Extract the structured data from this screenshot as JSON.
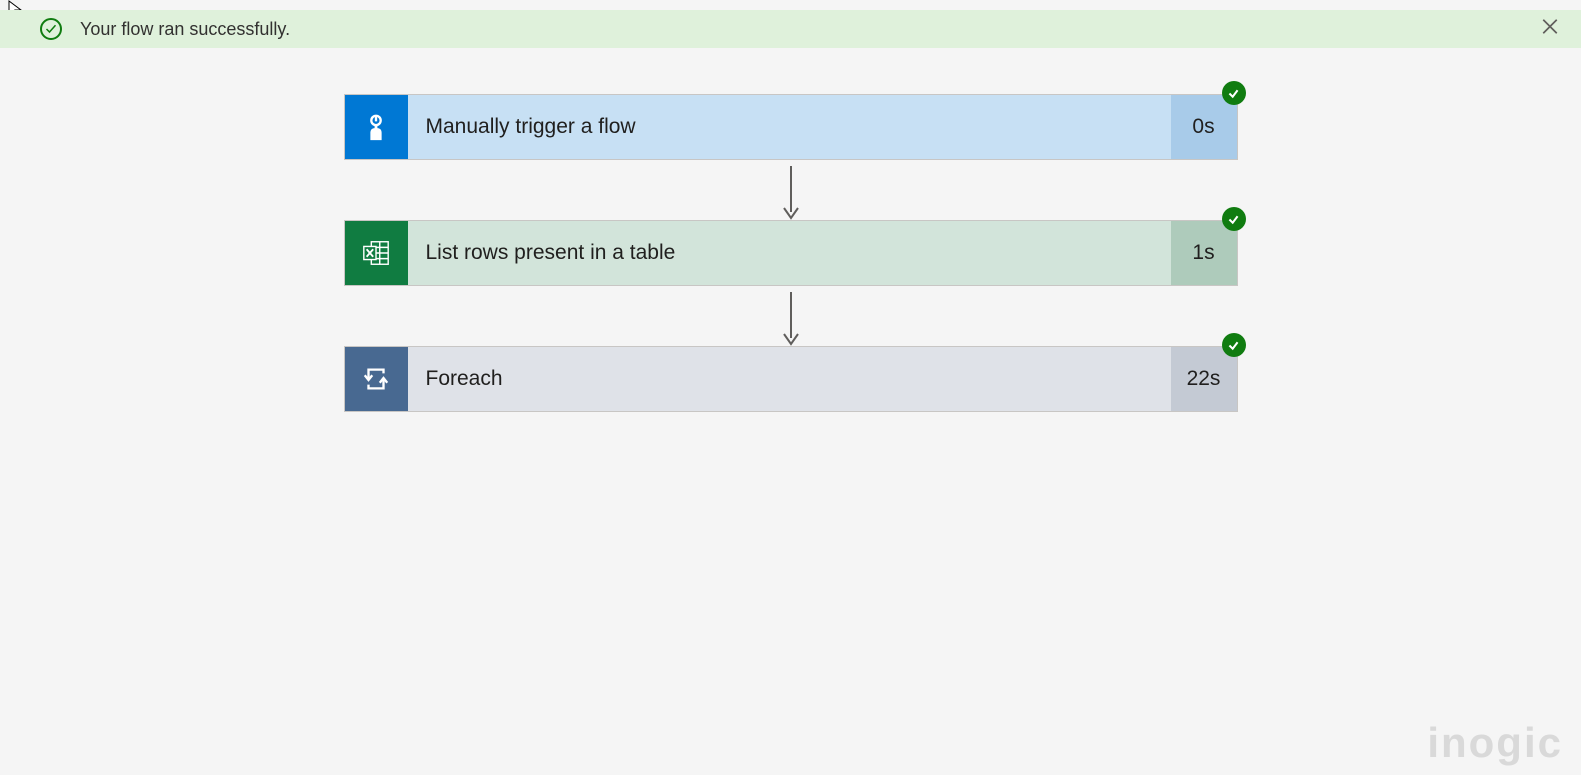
{
  "banner": {
    "message": "Your flow ran successfully."
  },
  "steps": [
    {
      "icon": "trigger-icon",
      "label": "Manually trigger a flow",
      "duration": "0s",
      "status": "success"
    },
    {
      "icon": "excel-icon",
      "label": "List rows present in a table",
      "duration": "1s",
      "status": "success"
    },
    {
      "icon": "loop-icon",
      "label": "Foreach",
      "duration": "22s",
      "status": "success"
    }
  ],
  "watermark": "inogic"
}
